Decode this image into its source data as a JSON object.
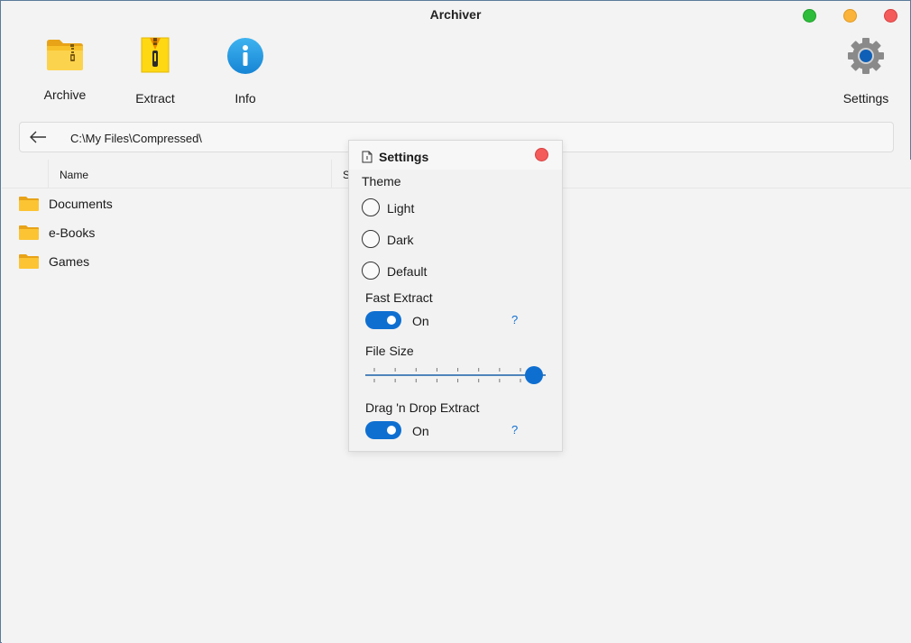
{
  "window": {
    "title": "Archiver",
    "controls": {
      "maximize_color": "#2dbd3a",
      "minimize_color": "#fbb33a",
      "close_color": "#f45b5b"
    }
  },
  "toolbar": {
    "archive_label": "Archive",
    "extract_label": "Extract",
    "info_label": "Info",
    "settings_label": "Settings",
    "icons": {
      "archive": "zip-folder-icon",
      "extract": "zipper-file-icon",
      "info": "info-icon",
      "settings": "gear-icon"
    }
  },
  "address": {
    "back_icon": "arrow-left-icon",
    "path": "C:\\My Files\\Compressed\\"
  },
  "file_list": {
    "columns": [
      "Name",
      "S"
    ],
    "items": [
      {
        "name": "Documents",
        "icon": "folder-icon"
      },
      {
        "name": "e-Books",
        "icon": "folder-icon"
      },
      {
        "name": "Games",
        "icon": "folder-icon"
      }
    ]
  },
  "settings_dialog": {
    "title": "Settings",
    "theme_label": "Theme",
    "theme_options": [
      "Light",
      "Dark",
      "Default"
    ],
    "fast_extract": {
      "label": "Fast Extract",
      "state": "On",
      "help": "?"
    },
    "file_size": {
      "label": "File Size",
      "value": 1.0,
      "tick_count": 8
    },
    "drag_drop_extract": {
      "label": "Drag 'n Drop Extract",
      "state": "On",
      "help": "?"
    },
    "accent_color": "#0f6fd1"
  }
}
